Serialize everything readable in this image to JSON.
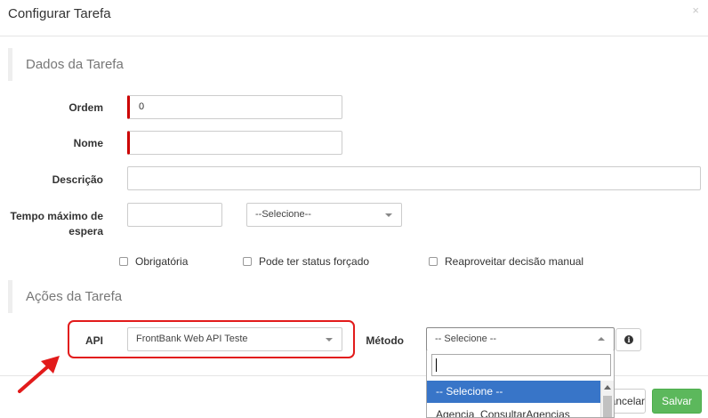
{
  "modal": {
    "title": "Configurar Tarefa",
    "close": "×"
  },
  "sections": {
    "dados": "Dados da Tarefa",
    "acoes": "Ações da Tarefa"
  },
  "form": {
    "ordem_label": "Ordem",
    "ordem_value": "0",
    "nome_label": "Nome",
    "nome_value": "",
    "descricao_label": "Descrição",
    "descricao_value": "",
    "tempo_label_1": "Tempo máximo de",
    "tempo_label_2": "espera",
    "tempo_value": "",
    "tempo_unit_selected": "--Selecione--"
  },
  "checkboxes": [
    {
      "label": "Obrigatória",
      "checked": false
    },
    {
      "label": "Pode ter status forçado",
      "checked": false
    },
    {
      "label": "Reaproveitar decisão manual",
      "checked": false
    }
  ],
  "api": {
    "label": "API",
    "selected": "FrontBank Web API Teste"
  },
  "metodo": {
    "label": "Método",
    "selected": "-- Selecione --",
    "search_value": "",
    "options": [
      "-- Selecione --",
      "Agencia_ConsultarAgencias"
    ]
  },
  "footer": {
    "cancel_label": "Cancelar",
    "save_label": "Salvar"
  },
  "colors": {
    "highlight": "#e21b1b",
    "selected_option": "#3875c8",
    "save": "#5cb85c",
    "required": "#cc0000"
  },
  "icons": {
    "info": "info-circle-icon",
    "arrow": "red-arrow-annotation"
  }
}
